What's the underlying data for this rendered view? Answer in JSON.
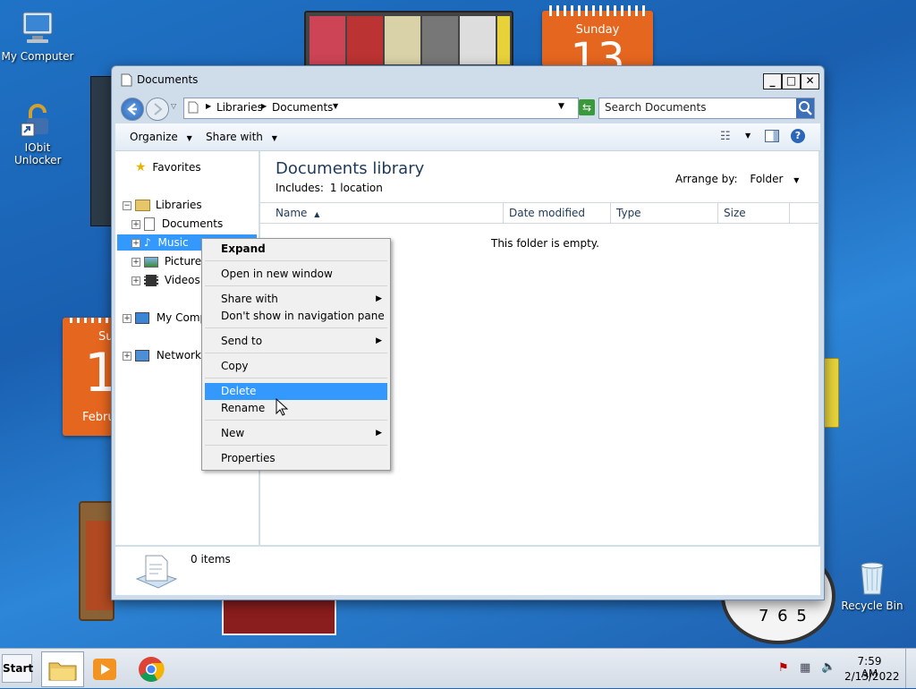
{
  "desktop": {
    "icons": [
      {
        "label": "My Computer"
      },
      {
        "label": "IObit Unlocker"
      },
      {
        "label": "Recycle Bin"
      }
    ],
    "calendar_top": {
      "day_name": "Sunday",
      "day_number": "13"
    },
    "calendar_left": {
      "day_name": "Su",
      "day_number": "1",
      "month": "Febru"
    },
    "clock_digits": "7 6 5"
  },
  "window": {
    "title": "Documents",
    "controls": {
      "minimize": "_",
      "maximize": "□",
      "close": "✕"
    },
    "breadcrumb": [
      "Libraries",
      "Documents"
    ],
    "search_placeholder": "Search Documents",
    "toolbar": {
      "organize": "Organize",
      "share_with": "Share with"
    },
    "nav": {
      "favorites": "Favorites",
      "libraries": "Libraries",
      "documents": "Documents",
      "music": "Music",
      "pictures": "Pictures",
      "videos": "Videos",
      "computer": "My Comp",
      "network": "Network"
    },
    "library": {
      "title": "Documents library",
      "includes_label": "Includes:",
      "includes_link": "1 location",
      "arrange_label": "Arrange by:",
      "arrange_value": "Folder"
    },
    "columns": [
      "Name",
      "Date modified",
      "Type",
      "Size"
    ],
    "empty_message": "This folder is empty.",
    "details": {
      "count": "0 items"
    }
  },
  "context_menu": {
    "items": [
      {
        "label": "Expand",
        "bold": true
      },
      {
        "label": "Open in new window"
      },
      {
        "label": "Share with",
        "submenu": true
      },
      {
        "label": "Don't show in navigation pane"
      },
      {
        "label": "Send to",
        "submenu": true
      },
      {
        "label": "Copy"
      },
      {
        "label": "Delete",
        "highlighted": true
      },
      {
        "label": "Rename"
      },
      {
        "label": "New",
        "submenu": true
      },
      {
        "label": "Properties"
      }
    ]
  },
  "taskbar": {
    "start": "Start",
    "time": "7:59 AM",
    "date": "2/13/2022",
    "pinned": [
      "explorer-icon",
      "media-player-icon",
      "chrome-icon"
    ]
  },
  "colors": {
    "accent": "#3399ff",
    "calendar": "#e5661f"
  }
}
